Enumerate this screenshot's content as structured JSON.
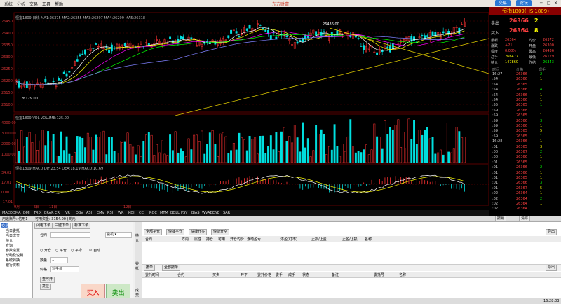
{
  "menu": {
    "items": [
      "系统",
      "分析",
      "交易",
      "工具",
      "帮助"
    ],
    "title": "东方财富",
    "trade_btn": "交易",
    "forum_btn": "论坛"
  },
  "chart": {
    "header_main": "恒指1809-日线  MA1:26375  MA2:26355  MA3:26297  MA4:26299  MA5:26318",
    "vol_header": "恒指1809 VOL  VOLUME:125.00",
    "macd_header": "恒指1809 MACD  DIF:23.54  DEA:18.19  MACD:10.69",
    "price_high_label": "26436.00",
    "price_low_label": "26129.00",
    "y_labels_main": [
      "26450",
      "26400",
      "26350",
      "26300",
      "26250",
      "26200",
      "26150",
      "26100"
    ],
    "y_labels_vol": [
      "4000.00",
      "3000.00",
      "2000.00",
      "1000.00"
    ],
    "y_labels_macd": [
      "34.02",
      "17.01",
      "0.00",
      "-17.01"
    ],
    "x_labels": [
      "9月",
      "6日",
      "11日",
      "12日"
    ],
    "indicator_tabs": [
      "MACD",
      "DMA",
      "DMI",
      "TRIX",
      "BRAR",
      "CR",
      "VR",
      "OBV",
      "ASI",
      "EMV",
      "RSI",
      "WR",
      "KDJ",
      "CCI",
      "ROC",
      "MTM",
      "BOLL",
      "PSY",
      "BIAS",
      "WVAD",
      "ENE",
      "SAR"
    ],
    "colors": {
      "up": "#ff3232",
      "down": "#00e0e0",
      "ma1": "#ffffff",
      "ma2": "#ffff00",
      "ma3": "#ff00ff",
      "ma4": "#00ff00",
      "ma5": "#8080ff",
      "grid": "#5a0000"
    }
  },
  "quote": {
    "title": "恒指1809(HSI1809)",
    "sell_label": "卖出",
    "sell_price": "26366",
    "sell_qty": "2",
    "buy_label": "买入",
    "buy_price": "26364",
    "buy_qty": "8",
    "rows": [
      {
        "l": "最新",
        "v": "26364",
        "l2": "均价",
        "v2": "26372"
      },
      {
        "l": "涨跌",
        "v": "+21",
        "l2": "开盘",
        "v2": "26300"
      },
      {
        "l": "幅度",
        "v": "0.08%",
        "l2": "最高",
        "v2": "26436"
      },
      {
        "l": "总手",
        "v": "266477",
        "l2": "最低",
        "v2": "26129"
      },
      {
        "l": "持仓",
        "v": "147860",
        "l2": "昨结",
        "v2": "26343"
      }
    ],
    "tick_header": [
      "时间",
      "价格",
      "现手"
    ],
    "ticks": [
      [
        "16:27",
        "26366",
        "2"
      ],
      [
        ":54",
        "26366",
        "1"
      ],
      [
        ":54",
        "26365",
        "1"
      ],
      [
        ":54",
        "26366",
        "4"
      ],
      [
        ":54",
        "26366",
        "1"
      ],
      [
        ":54",
        "26366",
        "1"
      ],
      [
        ":55",
        "26365",
        "1"
      ],
      [
        ":59",
        "26368",
        "1"
      ],
      [
        ":59",
        "26365",
        "1"
      ],
      [
        ":59",
        "26366",
        "3"
      ],
      [
        ":59",
        "26366",
        "1"
      ],
      [
        ":59",
        "26365",
        "5"
      ],
      [
        ":59",
        "26365",
        "1"
      ],
      [
        "16:28",
        "26366",
        "1"
      ],
      [
        ":01",
        "26365",
        "3"
      ],
      [
        ":00",
        "26367",
        "2"
      ],
      [
        ":00",
        "26366",
        "1"
      ],
      [
        ":01",
        "26365",
        "1"
      ],
      [
        ":01",
        "26366",
        "2"
      ],
      [
        ":01",
        "26366",
        "1"
      ],
      [
        ":01",
        "26365",
        "1"
      ],
      [
        ":01",
        "26366",
        "3"
      ],
      [
        ":01",
        "26367",
        "5"
      ],
      [
        ":02",
        "26364",
        "1"
      ],
      [
        ":02",
        "26364",
        "2"
      ],
      [
        ":02",
        "26364",
        "1"
      ],
      [
        ":02",
        "26364",
        "1"
      ]
    ]
  },
  "bottom": {
    "account_label": "用途账号: 信用1",
    "avail_funds": "可用资金: 3154.00 (美元)",
    "tree": [
      "交易",
      "当日委托",
      "当日成交",
      "持仓",
      "查询",
      "参数设置",
      "帮助及说明",
      "系统转换",
      "银行资料"
    ],
    "order_tabs": [
      "闪电下单",
      "三键下单",
      "标准下单"
    ],
    "contract_label": "合约",
    "qty_label": "数量",
    "qty_value": "1",
    "price_label": "价格",
    "price_type": "对手价",
    "cb_open": "开仓",
    "cb_close": "平仓",
    "cb_today": "平今",
    "cb_auto": "自动",
    "buy_btn": "买入",
    "sell_btn": "卖出",
    "side_btns": [
      "查可开",
      "复位"
    ],
    "tabs_top": [
      "全部平仓",
      "快捷平仓",
      "快捷开多",
      "快捷开空"
    ],
    "pos_cols": [
      "合约",
      "方向",
      "属性",
      "持仓",
      "可用",
      "开仓均价",
      "浮动盈亏",
      "浮盈(盯市)",
      "止损/止盈",
      "止盈/止损",
      "名称"
    ],
    "order_sub_tabs": [
      "撤单",
      "全部撤单"
    ],
    "order_cols": [
      "委托时间",
      "合约",
      "买卖",
      "开平",
      "委托价格",
      "委手",
      "成手",
      "状态",
      "备注",
      "委托号",
      "名称"
    ],
    "right_btns": [
      "撤销",
      "清除"
    ],
    "export": "导出",
    "side_tabs": [
      "持仓",
      "委托",
      "成交"
    ],
    "status_time": "16:28:03"
  }
}
